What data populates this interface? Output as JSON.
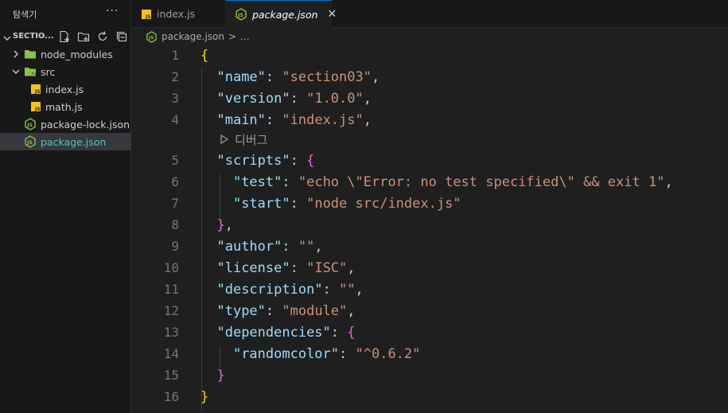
{
  "sidebar": {
    "title": "탐색기",
    "more": "···",
    "section_label": "SECTIO...",
    "actions": [
      "new-file-icon",
      "new-folder-icon",
      "refresh-icon",
      "collapse-all-icon"
    ],
    "tree": [
      {
        "label": "node_modules",
        "kind": "folder",
        "expanded": false
      },
      {
        "label": "src",
        "kind": "folder",
        "expanded": true
      },
      {
        "label": "index.js",
        "kind": "js"
      },
      {
        "label": "math.js",
        "kind": "js"
      },
      {
        "label": "package-lock.json",
        "kind": "json"
      },
      {
        "label": "package.json",
        "kind": "json",
        "selected": true
      }
    ]
  },
  "tabs": [
    {
      "label": "index.js",
      "icon": "js-file-icon",
      "active": false
    },
    {
      "label": "package.json",
      "icon": "json-file-icon",
      "active": true,
      "close": "✕"
    }
  ],
  "breadcrumb": {
    "file": "package.json",
    "sep": ">",
    "rest": "..."
  },
  "codelens": {
    "label": "디버그"
  },
  "editor": {
    "line_numbers": [
      "1",
      "2",
      "3",
      "4",
      "5",
      "6",
      "7",
      "8",
      "9",
      "10",
      "11",
      "12",
      "13",
      "14",
      "15",
      "16"
    ]
  },
  "colors": {
    "accent": "#0078d4",
    "key": "#9cdcfe",
    "string": "#ce9178",
    "brace1": "#ffd700",
    "brace2": "#da70d6",
    "js_icon": "#f1c21b",
    "json_icon": "#8bc34a"
  }
}
